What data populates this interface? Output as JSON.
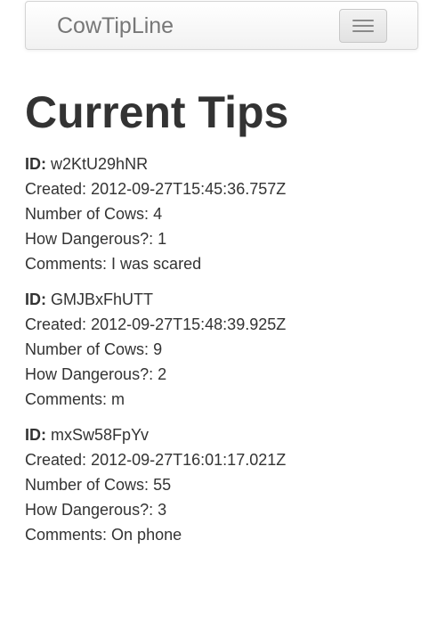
{
  "navbar": {
    "brand": "CowTipLine"
  },
  "page": {
    "title": "Current Tips"
  },
  "labels": {
    "id": "ID:",
    "created": "Created:",
    "cows": "Number of Cows:",
    "danger": "How Dangerous?:",
    "comments": "Comments:"
  },
  "tips": [
    {
      "id": "w2KtU29hNR",
      "created": "2012-09-27T15:45:36.757Z",
      "cows": "4",
      "danger": "1",
      "comments": "I was scared"
    },
    {
      "id": "GMJBxFhUTT",
      "created": "2012-09-27T15:48:39.925Z",
      "cows": "9",
      "danger": "2",
      "comments": "m"
    },
    {
      "id": "mxSw58FpYv",
      "created": "2012-09-27T16:01:17.021Z",
      "cows": "55",
      "danger": "3",
      "comments": "On phone"
    }
  ],
  "icons": {
    "menu": "hamburger-menu-icon"
  }
}
